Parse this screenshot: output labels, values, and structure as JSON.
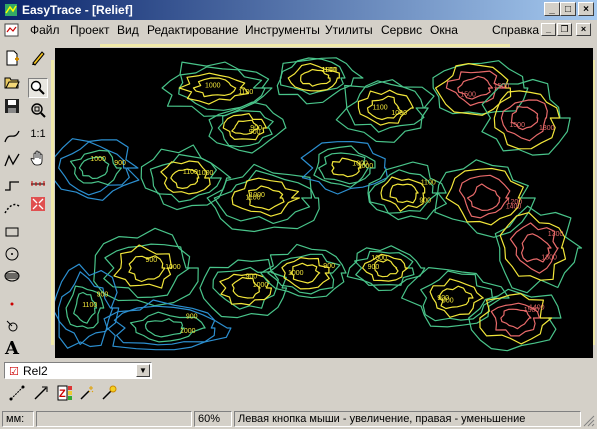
{
  "window": {
    "title": "EasyTrace - [Relief]",
    "minimize_glyph": "_",
    "maximize_glyph": "□",
    "close_glyph": "×"
  },
  "menu": {
    "items": [
      "Файл",
      "Проект",
      "Вид",
      "Редактирование",
      "Инструменты",
      "Утилиты",
      "Сервис",
      "Окна"
    ],
    "help": "Справка",
    "mdi_minimize": "_",
    "mdi_restore": "❐",
    "mdi_close": "×"
  },
  "toolbar": {
    "zoom_1to1": "1:1",
    "text_tool": "A"
  },
  "layer": {
    "selected": "Rel2"
  },
  "map": {
    "contour_labels": [
      "1100",
      "900",
      "1000",
      "1200",
      "1300",
      "1500",
      "1400"
    ],
    "colors": {
      "low": "#2c8fd0",
      "mid": "#49c48a",
      "high_yellow": "#f2e63a",
      "peak_pink": "#e86a6a",
      "ruler": "#f0e9a8"
    }
  },
  "status": {
    "units": "мм:",
    "zoom": "60%",
    "hint": "Левая кнопка мыши - увеличение, правая - уменьшение"
  }
}
